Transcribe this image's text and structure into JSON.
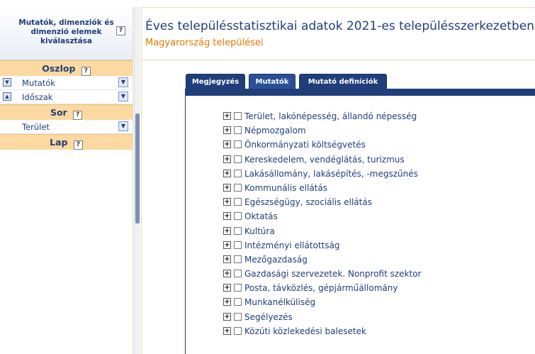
{
  "left": {
    "header_title": "Mutatók, dimenziók és dimenzió elemek kiválasztása",
    "help_glyph": "?",
    "sections": {
      "column": {
        "label": "Oszlop",
        "items": [
          {
            "label": "Mutatók",
            "sort": "▼"
          },
          {
            "label": "Időszak",
            "sort": "▲"
          }
        ]
      },
      "row": {
        "label": "Sor",
        "items": [
          {
            "label": "Terület"
          }
        ]
      },
      "page": {
        "label": "Lap"
      }
    },
    "dropdown_glyph": "▼"
  },
  "main": {
    "title": "Éves településstatisztikai adatok 2021-es településszerkezetben",
    "subtitle": "Magyarország települései",
    "tabs": [
      {
        "label": "Megjegyzés"
      },
      {
        "label": "Mutatók"
      },
      {
        "label": "Mutató definíciók"
      }
    ],
    "expand_glyph": "+",
    "tree": [
      "Terület, lakónépesség, állandó népesség",
      "Népmozgalom",
      "Önkormányzati költségvetés",
      "Kereskedelem, vendéglátás, turizmus",
      "Lakásállomány, lakásépítés, -megszűnés",
      "Kommunális ellátás",
      "Egészségügy, szociális ellátás",
      "Oktatás",
      "Kultúra",
      "Intézményi ellátottság",
      "Mezőgazdaság",
      "Gazdasági szervezetek. Nonprofit szektor",
      "Posta, távközlés, gépjárműállomány",
      "Munkanélküliség",
      "Segélyezés",
      "Közúti közlekedési balesetek"
    ]
  }
}
